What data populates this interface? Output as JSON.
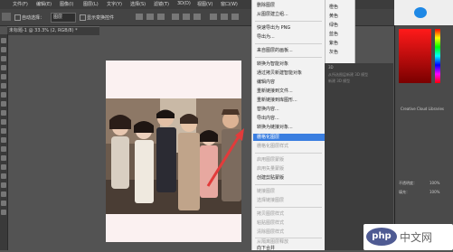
{
  "menubar": {
    "items": [
      "文件(F)",
      "编辑(E)",
      "图像(I)",
      "图层(L)",
      "文字(Y)",
      "选择(S)",
      "滤镜(T)",
      "3D(D)",
      "视图(V)",
      "窗口(W)",
      "帮助(H)"
    ]
  },
  "optbar": {
    "auto_select_label": "自动选择：",
    "auto_select_value": "图层",
    "show_transform_label": "显示变换控件"
  },
  "document": {
    "tab_title": "未标题-1 @ 33.3% (2, RGB/8) *"
  },
  "context_menu": {
    "items": [
      {
        "label": "删除图层",
        "state": "normal"
      },
      {
        "label": "从图层建立组...",
        "state": "normal"
      },
      {
        "label": "快速导出为 PNG",
        "state": "normal"
      },
      {
        "label": "导出为...",
        "state": "normal"
      },
      {
        "label": "来自图层的画板...",
        "state": "normal"
      },
      {
        "label": "转换为智能对象",
        "state": "normal"
      },
      {
        "label": "通过拷贝新建智能对象",
        "state": "normal"
      },
      {
        "label": "编辑内容",
        "state": "normal"
      },
      {
        "label": "重新链接到文件...",
        "state": "normal"
      },
      {
        "label": "重新链接到库图形...",
        "state": "normal"
      },
      {
        "label": "替换内容...",
        "state": "normal"
      },
      {
        "label": "导出内容...",
        "state": "normal"
      },
      {
        "label": "转换为链接对象...",
        "state": "normal"
      },
      {
        "label": "栅格化图层",
        "state": "selected"
      },
      {
        "label": "栅格化图层样式",
        "state": "disabled"
      },
      {
        "label": "启用图层蒙版",
        "state": "disabled"
      },
      {
        "label": "启用矢量蒙版",
        "state": "disabled"
      },
      {
        "label": "创建剪贴蒙版",
        "state": "normal"
      },
      {
        "label": "链接图层",
        "state": "disabled"
      },
      {
        "label": "选择链接图层",
        "state": "disabled"
      },
      {
        "label": "拷贝图层样式",
        "state": "disabled"
      },
      {
        "label": "粘贴图层样式",
        "state": "disabled"
      },
      {
        "label": "清除图层样式",
        "state": "disabled"
      },
      {
        "label": "从隔离图层释放",
        "state": "disabled"
      },
      {
        "label": "向下合并",
        "state": "normal"
      }
    ]
  },
  "color_menu": {
    "items": [
      "橙色",
      "黄色",
      "绿色",
      "蓝色",
      "紫色",
      "灰色"
    ]
  },
  "side_panel": {
    "items": [
      "新建 3D 模型",
      "从所选图层新建 3D 模型",
      "新建 3D 模型"
    ],
    "title": "3D"
  },
  "right_panel": {
    "cc_label": "Creative Cloud Libraries",
    "mode_label": "不透明度：",
    "mode_value": "100%",
    "fill_label": "填充：",
    "fill_value": "100%"
  },
  "watermark": {
    "text": "中文网",
    "logo": "php"
  },
  "colors": {
    "menu_selected": "#3a7ee0",
    "canvas_bg": "#fbf1f1",
    "workspace": "#535353"
  }
}
